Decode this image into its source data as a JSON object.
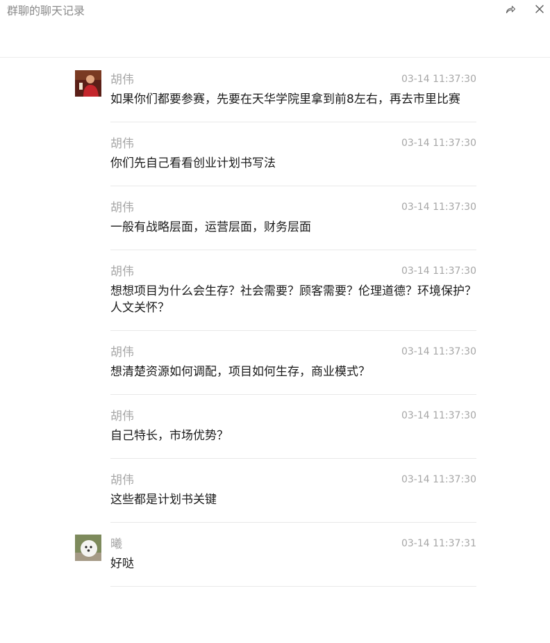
{
  "window": {
    "title": "群聊的聊天记录"
  },
  "icons": {
    "share": "share-forward-icon",
    "close": "close-icon"
  },
  "colors": {
    "text": "#1a1a1a",
    "muted": "#a6a6a6",
    "divider": "#e8e8e8"
  },
  "messages": [
    {
      "sender": "胡伟",
      "time": "03-14 11:37:30",
      "text": "如果你们都要参赛，先要在天华学院里拿到前8左右，再去市里比赛",
      "avatar": true,
      "avatar_kind": "man-red-shirt"
    },
    {
      "sender": "胡伟",
      "time": "03-14 11:37:30",
      "text": "你们先自己看看创业计划书写法",
      "avatar": false
    },
    {
      "sender": "胡伟",
      "time": "03-14 11:37:30",
      "text": "一般有战略层面，运营层面，财务层面",
      "avatar": false
    },
    {
      "sender": "胡伟",
      "time": "03-14 11:37:30",
      "text": "想想项目为什么会生存？社会需要？顾客需要？伦理道德？环境保护？人文关怀？",
      "avatar": false
    },
    {
      "sender": "胡伟",
      "time": "03-14 11:37:30",
      "text": "想清楚资源如何调配，项目如何生存，商业模式？",
      "avatar": false
    },
    {
      "sender": "胡伟",
      "time": "03-14 11:37:30",
      "text": "自己特长，市场优势？",
      "avatar": false
    },
    {
      "sender": "胡伟",
      "time": "03-14 11:37:30",
      "text": "这些都是计划书关键",
      "avatar": false
    },
    {
      "sender": "曦",
      "time": "03-14 11:37:31",
      "text": "好哒",
      "avatar": true,
      "avatar_kind": "white-puppy"
    }
  ]
}
